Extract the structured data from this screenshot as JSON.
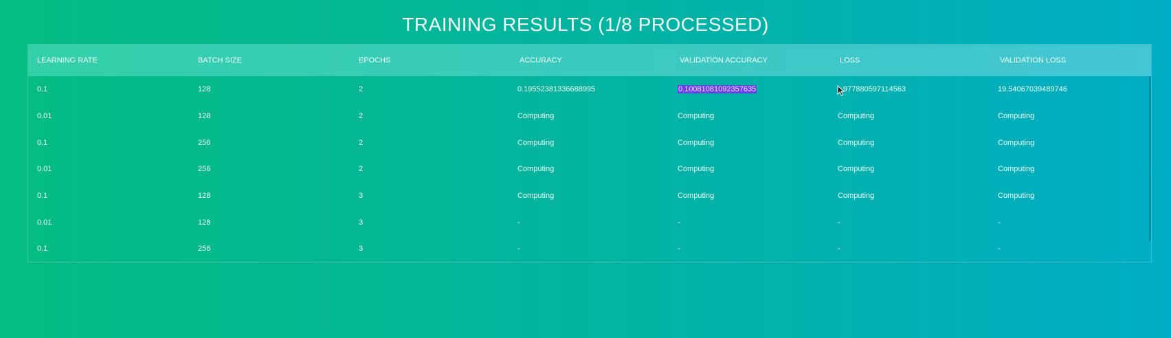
{
  "title": "TRAINING RESULTS (1/8 PROCESSED)",
  "table": {
    "headers": [
      "LEARNING RATE",
      "BATCH SIZE",
      "EPOCHS",
      "ACCURACY",
      "VALIDATION ACCURACY",
      "LOSS",
      "VALIDATION LOSS"
    ],
    "rows": [
      {
        "learning_rate": "0.1",
        "batch_size": "128",
        "epochs": "2",
        "accuracy": "0.19552381336688995",
        "validation_accuracy": "0.10081081092357635",
        "loss": "977880597114563",
        "validation_loss": "19.54067039489746"
      },
      {
        "learning_rate": "0.01",
        "batch_size": "128",
        "epochs": "2",
        "accuracy": "Computing",
        "validation_accuracy": "Computing",
        "loss": "Computing",
        "validation_loss": "Computing"
      },
      {
        "learning_rate": "0.1",
        "batch_size": "256",
        "epochs": "2",
        "accuracy": "Computing",
        "validation_accuracy": "Computing",
        "loss": "Computing",
        "validation_loss": "Computing"
      },
      {
        "learning_rate": "0.01",
        "batch_size": "256",
        "epochs": "2",
        "accuracy": "Computing",
        "validation_accuracy": "Computing",
        "loss": "Computing",
        "validation_loss": "Computing"
      },
      {
        "learning_rate": "0.1",
        "batch_size": "128",
        "epochs": "3",
        "accuracy": "Computing",
        "validation_accuracy": "Computing",
        "loss": "Computing",
        "validation_loss": "Computing"
      },
      {
        "learning_rate": "0.01",
        "batch_size": "128",
        "epochs": "3",
        "accuracy": "-",
        "validation_accuracy": "-",
        "loss": "-",
        "validation_loss": "-"
      },
      {
        "learning_rate": "0.1",
        "batch_size": "256",
        "epochs": "3",
        "accuracy": "-",
        "validation_accuracy": "-",
        "loss": "-",
        "validation_loss": "-"
      }
    ]
  },
  "colors": {
    "selection_highlight": "#6e3ef0",
    "background_start": "#05bc82",
    "background_end": "#00adc6"
  },
  "icons": {
    "cursor": "mouse-pointer-icon"
  }
}
